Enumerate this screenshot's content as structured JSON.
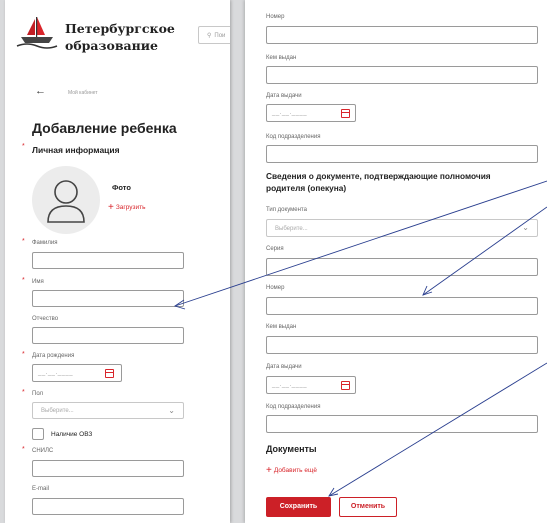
{
  "header": {
    "logo_line1": "Петербургское",
    "logo_line2": "образование",
    "search_placeholder": "Пои"
  },
  "left": {
    "breadcrumb": "Мой кабинет",
    "page_title": "Добавление ребенка",
    "section_personal": "Личная информация",
    "photo_label": "Фото",
    "upload_label": "Загрузить",
    "labels": {
      "surname": "Фамилия",
      "name": "Имя",
      "patronymic": "Отчество",
      "birth_date": "Дата рождения",
      "gender": "Пол",
      "ovz": "Наличие ОВЗ",
      "snils": "СНИЛС",
      "email": "E-mail"
    },
    "date_mask": "__.__.____",
    "select_placeholder": "Выберите..."
  },
  "right": {
    "labels": {
      "number_top": "Номер",
      "issued_by_1": "Кем выдан",
      "issue_date_1": "Дата выдачи",
      "division_code_1": "Код подразделения",
      "doc_type": "Тип документа",
      "series": "Серия",
      "number_2": "Номер",
      "issued_by_2": "Кем выдан",
      "issue_date_2": "Дата выдачи",
      "division_code_2": "Код подразделения"
    },
    "section_guardian_line1": "Сведения о документе, подтверждающие полномочия",
    "section_guardian_line2": "родителя (опекуна)",
    "select_placeholder": "Выберите...",
    "date_mask": "__.__.____",
    "section_documents": "Документы",
    "add_more_label": "Добавить ещё",
    "save_label": "Сохранить",
    "cancel_label": "Отменить"
  },
  "colors": {
    "accent": "#cc2027",
    "arrow": "#2a3f8f"
  }
}
